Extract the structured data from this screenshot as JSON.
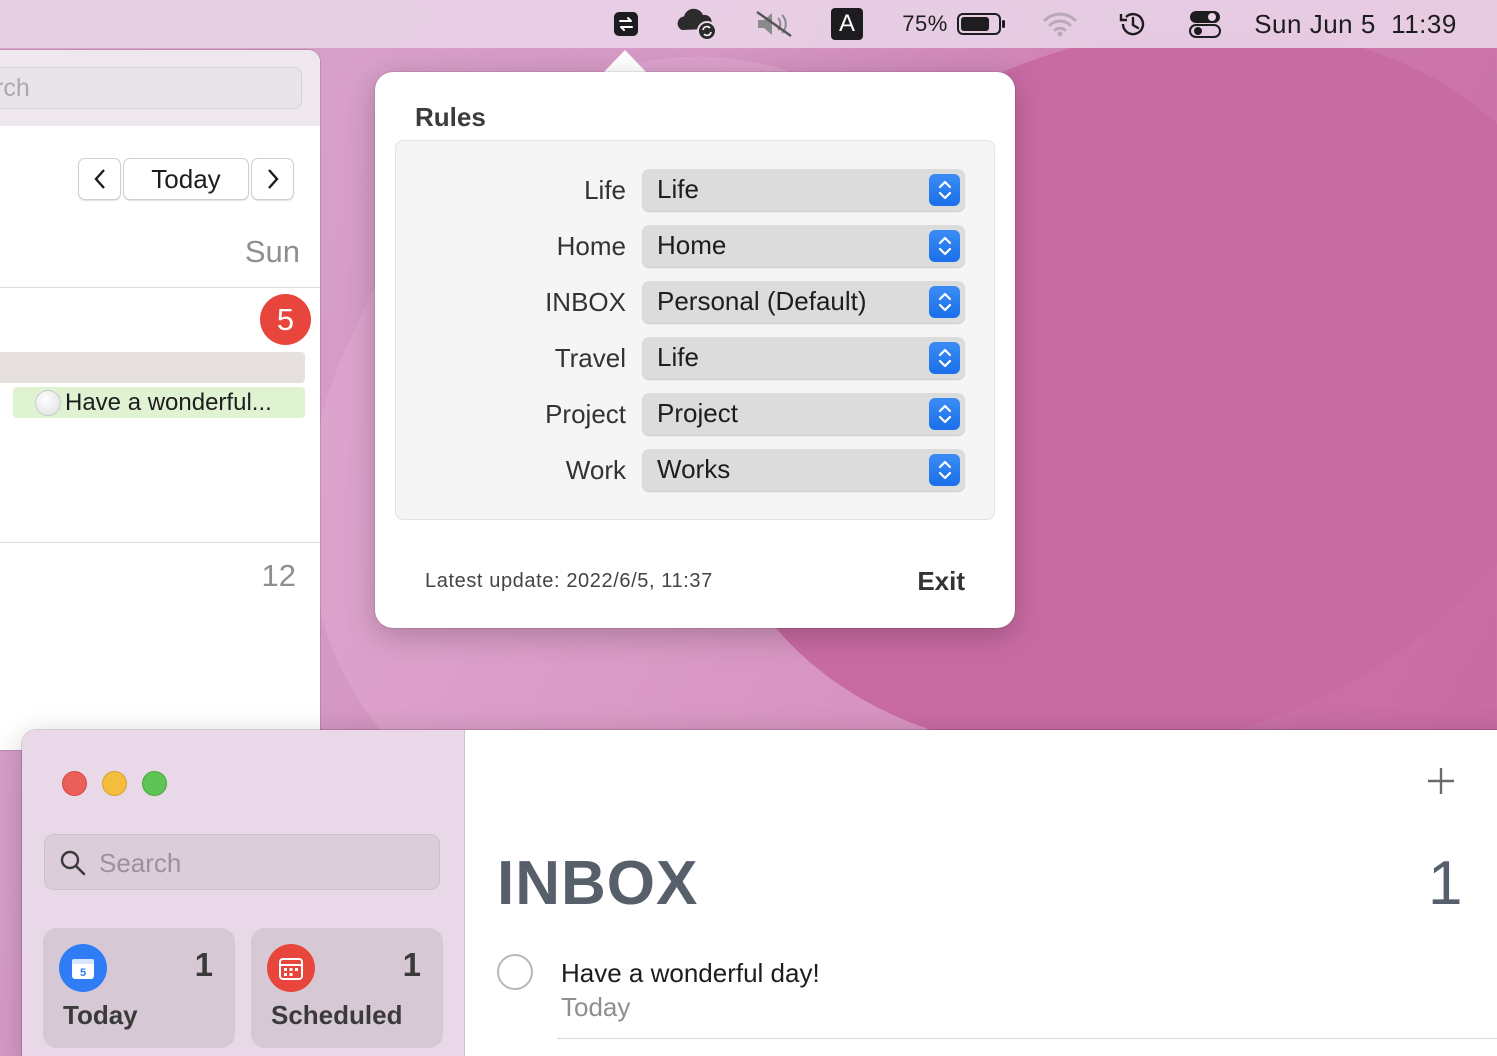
{
  "menubar": {
    "battery_percent": "75%",
    "input_source": "A",
    "date": "Sun Jun 5",
    "time": "11:39"
  },
  "calendar": {
    "search_placeholder": "rch",
    "today_button": "Today",
    "day_header": "Sun",
    "date_badge": "5",
    "event_title": "Have a wonderful...",
    "next_week_date": "12"
  },
  "rules_popover": {
    "title": "Rules",
    "rows": [
      {
        "label": "Life",
        "value": "Life"
      },
      {
        "label": "Home",
        "value": "Home"
      },
      {
        "label": "INBOX",
        "value": "Personal (Default)"
      },
      {
        "label": "Travel",
        "value": "Life"
      },
      {
        "label": "Project",
        "value": "Project"
      },
      {
        "label": "Work",
        "value": "Works"
      }
    ],
    "latest_update": "Latest update: 2022/6/5, 11:37",
    "exit_label": "Exit"
  },
  "reminders": {
    "search_placeholder": "Search",
    "smart_lists": [
      {
        "label": "Today",
        "count": "1",
        "icon": "calendar-today-icon",
        "color": "#2f7cf6",
        "day": "5"
      },
      {
        "label": "Scheduled",
        "count": "1",
        "icon": "calendar-scheduled-icon",
        "color": "#e8453c"
      }
    ],
    "list_title": "INBOX",
    "list_count": "1",
    "items": [
      {
        "title": "Have a wonderful day!",
        "subtitle": "Today"
      }
    ]
  }
}
